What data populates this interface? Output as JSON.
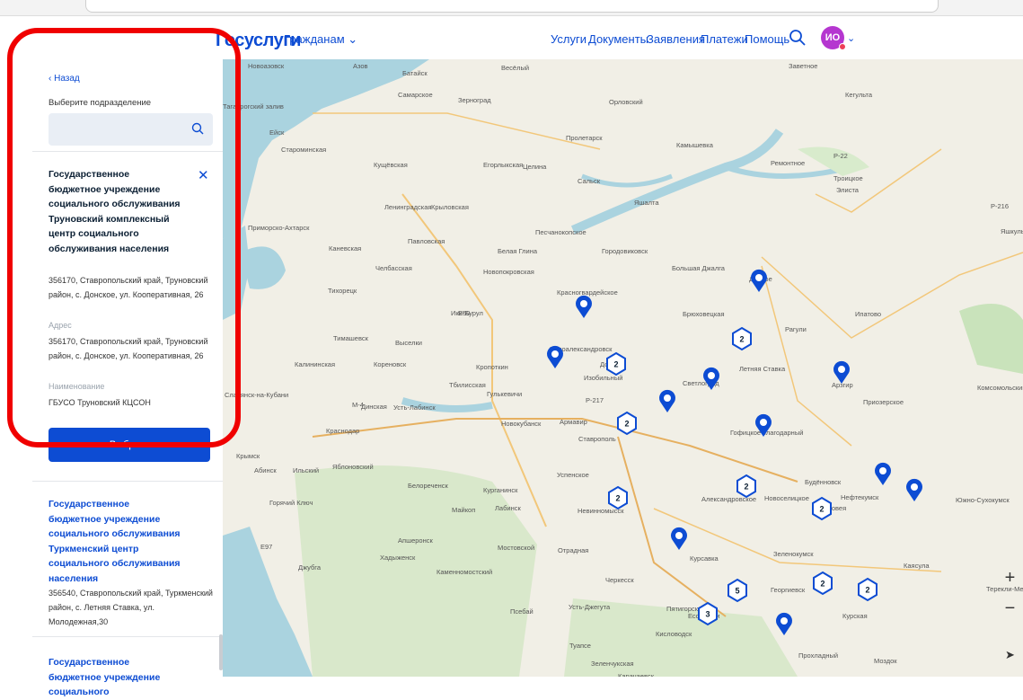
{
  "header": {
    "logo_part1": "Гос",
    "logo_part2": "услуги",
    "audience": "Гражданам",
    "nav": [
      "Услуги",
      "Документы",
      "Заявления",
      "Платежи",
      "Помощь"
    ],
    "avatar_initials": "ИО",
    "brand_color": "#0d4cd3",
    "accent_color": "#ee3f58"
  },
  "sidebar": {
    "back_label": "‹ Назад",
    "select_label": "Выберите подразделение",
    "search_placeholder": "",
    "selected_card": {
      "title": "Государственное бюджетное учреждение социального обслуживания Труновский комплексный центр социального обслуживания населения",
      "address_short": "356170, Ставропольский край, Труновский район, с. Донское, ул. Кооперативная, 26",
      "address_label": "Адрес",
      "address": "356170, Ставропольский край, Труновский район, с. Донское, ул. Кооперативная, 26",
      "name_label": "Наименование",
      "name": "ГБУСО Труновский КЦСОН",
      "select_button": "Выбрать"
    },
    "cards": [
      {
        "title": "Государственное бюджетное учреждение социального обслуживания Туркменский центр социального обслуживания населения",
        "address": "356540, Ставропольский край, Туркменский район, с. Летняя Ставка, ул. Молодежная,30"
      },
      {
        "title": "Государственное бюджетное учреждение социального"
      }
    ]
  },
  "map": {
    "labels": [
      "Азов",
      "Батайск",
      "Весёлый",
      "Заветное",
      "Самарское",
      "Зерноград",
      "Орловский",
      "Кегульта",
      "Ейск",
      "Староминская",
      "Пролетарск",
      "Камышевка",
      "Кущёвская",
      "Егорлыкская",
      "Целина",
      "Ремонтное",
      "Сальск",
      "Троицкое",
      "Элиста",
      "Ленинградская",
      "Крыловская",
      "Яшалта",
      "Песчанокопское",
      "Яшкуль",
      "Каневская",
      "Павловская",
      "Белая Глина",
      "Городовиковск",
      "Приморско-Ахтарск",
      "Челбасская",
      "Новопокровская",
      "Большая Джалга",
      "Дивное",
      "Красногвардейское",
      "Тихорецк",
      "Брюховецкая",
      "Ипатово",
      "Ики-Бурул",
      "Тимашевск",
      "Выселки",
      "Рагули",
      "Новоалександровск",
      "Кореновск",
      "Калининская",
      "Кропоткин",
      "Донское",
      "Летняя Ставка",
      "Тбилисская",
      "Изобильный",
      "Светлоград",
      "Арзгир",
      "Славянск-на-Кубани",
      "Динская",
      "Гулькевичи",
      "Усть-Лабинск",
      "Приозерское",
      "Комсомольский",
      "Новокубанск",
      "Ставрополь",
      "Гофицкое",
      "Благодарный",
      "Краснодар",
      "Армавир",
      "Крымск",
      "Абинск",
      "Яблоновский",
      "Ильский",
      "Курганинск",
      "Успенское",
      "Будённовск",
      "Белореченск",
      "Александровское",
      "Новоселицкое",
      "Нефтекумск",
      "Южно-Сухокумск",
      "Горячий Ключ",
      "Майкоп",
      "Лабинск",
      "Невинномысск",
      "Прасковея",
      "Апшеронск",
      "Хадыженск",
      "Мостовской",
      "Отрадная",
      "Курсавка",
      "Зеленокумск",
      "Джубга",
      "Каменномостский",
      "Каясула",
      "Черкесск",
      "Георгиевск",
      "Терекли-Мектеб",
      "Псебай",
      "Усть-Джегута",
      "Пятигорск",
      "Ессентуки",
      "Курская",
      "Кисловодск",
      "Туапсе",
      "Зеленчукская",
      "Карачаевск",
      "Прохладный",
      "Моздок",
      "Новоазовск",
      "Таганрогский залив",
      "Р-22",
      "Р-216",
      "Е50",
      "М-4",
      "Е97",
      "Р-217"
    ],
    "clusters": [
      "2",
      "2",
      "2",
      "2",
      "2",
      "2",
      "2",
      "5",
      "3",
      "2"
    ],
    "zoom_in": "+",
    "zoom_out": "−"
  }
}
